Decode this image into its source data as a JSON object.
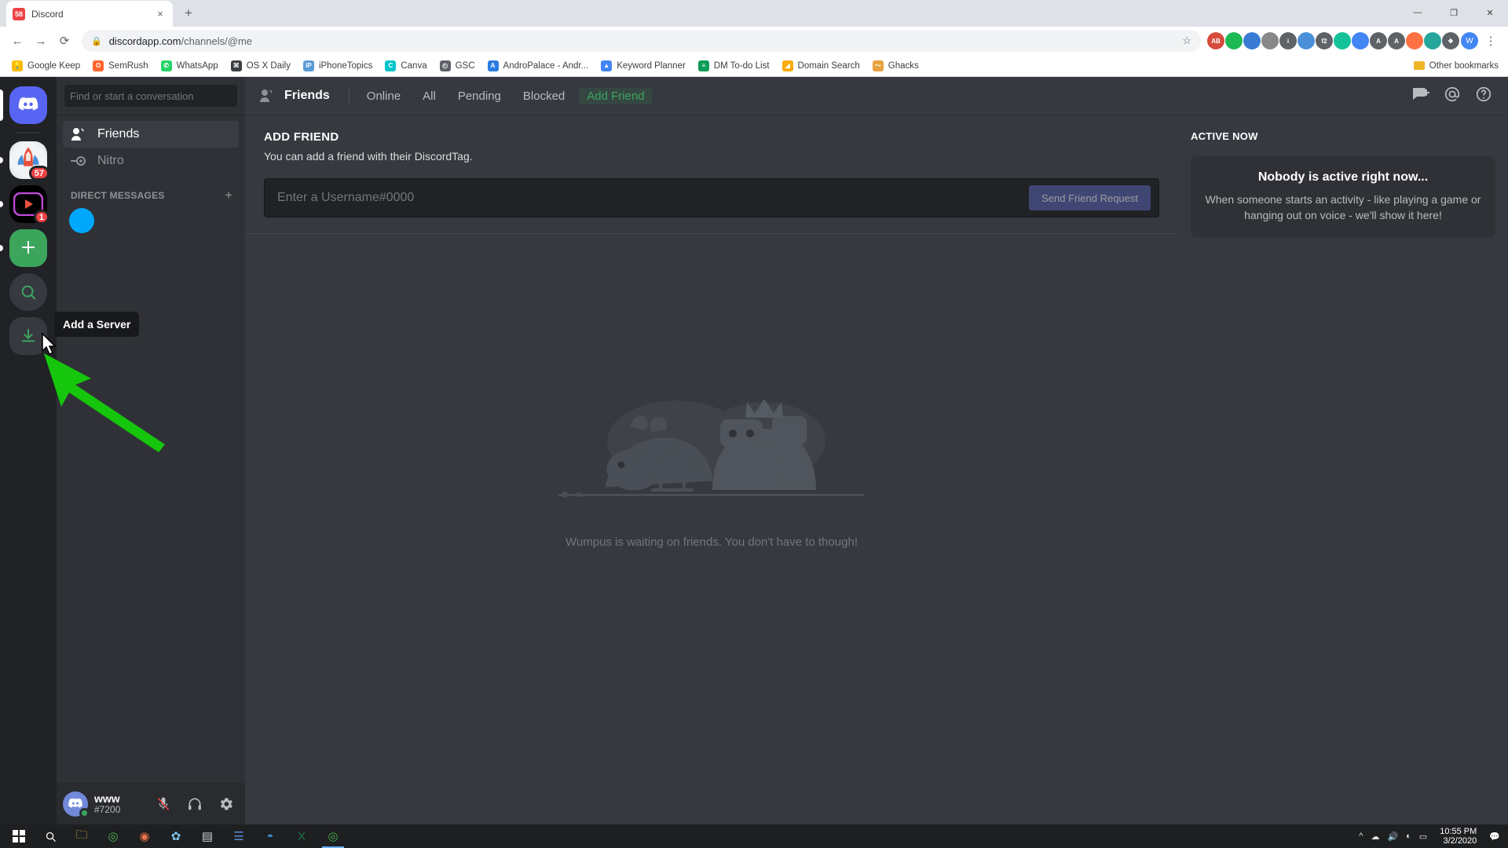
{
  "browser": {
    "tab": {
      "title": "Discord",
      "favicon_badge": "58",
      "close_label": "×"
    },
    "new_tab_label": "+",
    "window_controls": {
      "minimize": "—",
      "maximize": "❐",
      "close": "✕"
    },
    "nav": {
      "back": "←",
      "forward": "→",
      "reload": "⟳"
    },
    "omnibox": {
      "lock_icon": "🔒",
      "url_host": "discordapp.com",
      "url_path": "/channels/@me",
      "star_icon": "☆"
    },
    "extensions": [
      {
        "name": "ads-blocker-extension",
        "label": "AB",
        "color": "#d64b3c"
      },
      {
        "name": "green-shield-extension",
        "label": "",
        "color": "#1db954"
      },
      {
        "name": "blue-box-extension",
        "label": "",
        "color": "#3a7bd5"
      },
      {
        "name": "lastpass-extension",
        "label": "",
        "color": "#888888"
      },
      {
        "name": "info-extension",
        "label": "i",
        "color": "#5f6368"
      },
      {
        "name": "pen-extension",
        "label": "",
        "color": "#4a90d9"
      },
      {
        "name": "f2-extension",
        "label": "f2",
        "color": "#5f6368"
      },
      {
        "name": "grammarly-extension",
        "label": "",
        "color": "#15c39a"
      },
      {
        "name": "translate-extension",
        "label": "",
        "color": "#4285f4"
      },
      {
        "name": "letter-a-extension",
        "label": "A",
        "color": "#5f6368"
      },
      {
        "name": "letter-a2-extension",
        "label": "A",
        "color": "#5f6368"
      },
      {
        "name": "orange-dot-extension",
        "label": "",
        "color": "#ff7043"
      },
      {
        "name": "teal-extension",
        "label": "",
        "color": "#26a69a"
      },
      {
        "name": "puzzle-extension",
        "label": "❖",
        "color": "#5f6368"
      }
    ],
    "profile_initial": "W",
    "menu_icon": "⋮",
    "bookmarks": [
      {
        "label": "Google Keep",
        "color": "#fbbc04",
        "glyph": "💡"
      },
      {
        "label": "SemRush",
        "color": "#ff642d",
        "glyph": "O"
      },
      {
        "label": "WhatsApp",
        "color": "#25d366",
        "glyph": "✆"
      },
      {
        "label": "OS X Daily",
        "color": "#3c4043",
        "glyph": "⌘"
      },
      {
        "label": "iPhoneTopics",
        "color": "#5b9bd5",
        "glyph": "iP"
      },
      {
        "label": "Canva",
        "color": "#00c4cc",
        "glyph": "C"
      },
      {
        "label": "GSC",
        "color": "#5f6368",
        "glyph": "◴"
      },
      {
        "label": "AndroPalace - Andr...",
        "color": "#2a7de1",
        "glyph": "A"
      },
      {
        "label": "Keyword Planner",
        "color": "#4285f4",
        "glyph": "▲"
      },
      {
        "label": "DM To-do List",
        "color": "#0f9d58",
        "glyph": "≡"
      },
      {
        "label": "Domain Search",
        "color": "#f9ab00",
        "glyph": "◢"
      },
      {
        "label": "Ghacks",
        "color": "#e8a33d",
        "glyph": "〜"
      }
    ],
    "other_bookmarks": "Other bookmarks"
  },
  "discord": {
    "guilds": [
      {
        "name": "home-discord-guild",
        "type": "home",
        "badge": "",
        "selected": false
      },
      {
        "name": "server-guild-1",
        "type": "server1",
        "badge": "57",
        "selected": false
      },
      {
        "name": "server-guild-2",
        "type": "server2",
        "badge": "1",
        "selected": false
      },
      {
        "name": "add-a-server-guild",
        "type": "add",
        "badge": "",
        "selected": false
      },
      {
        "name": "explore-servers-guild",
        "type": "explore",
        "badge": "",
        "selected": false
      },
      {
        "name": "download-apps-guild",
        "type": "download",
        "badge": "",
        "selected": false
      }
    ],
    "search_placeholder": "Find or start a conversation",
    "nav_items": [
      {
        "label": "Friends",
        "icon": "friends-icon",
        "active": true
      },
      {
        "label": "Nitro",
        "icon": "nitro-icon",
        "active": false
      }
    ],
    "direct_messages_header": "DIRECT MESSAGES",
    "direct_messages_add": "+",
    "user": {
      "name": "www",
      "tag": "#7200",
      "mute_icon": "mic-muted-icon",
      "deafen_icon": "headphones-icon",
      "settings_icon": "gear-icon"
    },
    "topbar": {
      "title": "Friends",
      "tabs": [
        {
          "label": "Online",
          "active": false,
          "highlight": false
        },
        {
          "label": "All",
          "active": false,
          "highlight": false
        },
        {
          "label": "Pending",
          "active": false,
          "highlight": false
        },
        {
          "label": "Blocked",
          "active": false,
          "highlight": false
        },
        {
          "label": "Add Friend",
          "active": true,
          "highlight": true
        }
      ],
      "actions": [
        {
          "name": "new-group-dm-icon",
          "glyph": "✉"
        },
        {
          "name": "inbox-icon",
          "glyph": "@"
        },
        {
          "name": "help-icon",
          "glyph": "?"
        }
      ]
    },
    "add_friend": {
      "title": "ADD FRIEND",
      "subtitle": "You can add a friend with their DiscordTag.",
      "input_placeholder": "Enter a Username#0000",
      "input_value": "",
      "send_button": "Send Friend Request"
    },
    "empty_state": {
      "caption": "Wumpus is waiting on friends. You don't have to though!"
    },
    "active_now": {
      "title": "ACTIVE NOW",
      "heading": "Nobody is active right now...",
      "body": "When someone starts an activity - like playing a game or hanging out on voice - we'll show it here!"
    },
    "annotation": {
      "tooltip": "Add a Server",
      "arrow_color": "#16c60c"
    }
  },
  "taskbar": {
    "start": "⊞",
    "search": "🔍",
    "items": [
      {
        "name": "file-explorer-taskbar-icon",
        "color": "#f6c344",
        "glyph": "🗀"
      },
      {
        "name": "chrome-taskbar-icon",
        "color": "#4caf50",
        "glyph": "◎"
      },
      {
        "name": "media-taskbar-icon",
        "color": "#e8724a",
        "glyph": "◉"
      },
      {
        "name": "paint-taskbar-icon",
        "color": "#7ec4e8",
        "glyph": "✿"
      },
      {
        "name": "notepad-taskbar-icon",
        "color": "#c8cdd2",
        "glyph": "▤"
      },
      {
        "name": "photos-taskbar-icon",
        "color": "#5b8dd6",
        "glyph": "☰"
      },
      {
        "name": "earth-taskbar-icon",
        "color": "#3b8ed0",
        "glyph": "◓"
      },
      {
        "name": "excel-taskbar-icon",
        "color": "#1d7044",
        "glyph": "X"
      },
      {
        "name": "chrome-active-taskbar-icon",
        "color": "#4caf50",
        "glyph": "◎"
      }
    ],
    "tray": [
      {
        "name": "show-hidden-icons",
        "glyph": "⌃"
      },
      {
        "name": "onedrive-tray-icon",
        "glyph": "☁"
      },
      {
        "name": "volume-tray-icon",
        "glyph": "🔊"
      },
      {
        "name": "network-tray-icon",
        "glyph": "◰"
      },
      {
        "name": "battery-tray-icon",
        "glyph": "▭"
      }
    ],
    "time": "10:55 PM",
    "date": "3/2/2020",
    "notifications_icon": "💬"
  }
}
